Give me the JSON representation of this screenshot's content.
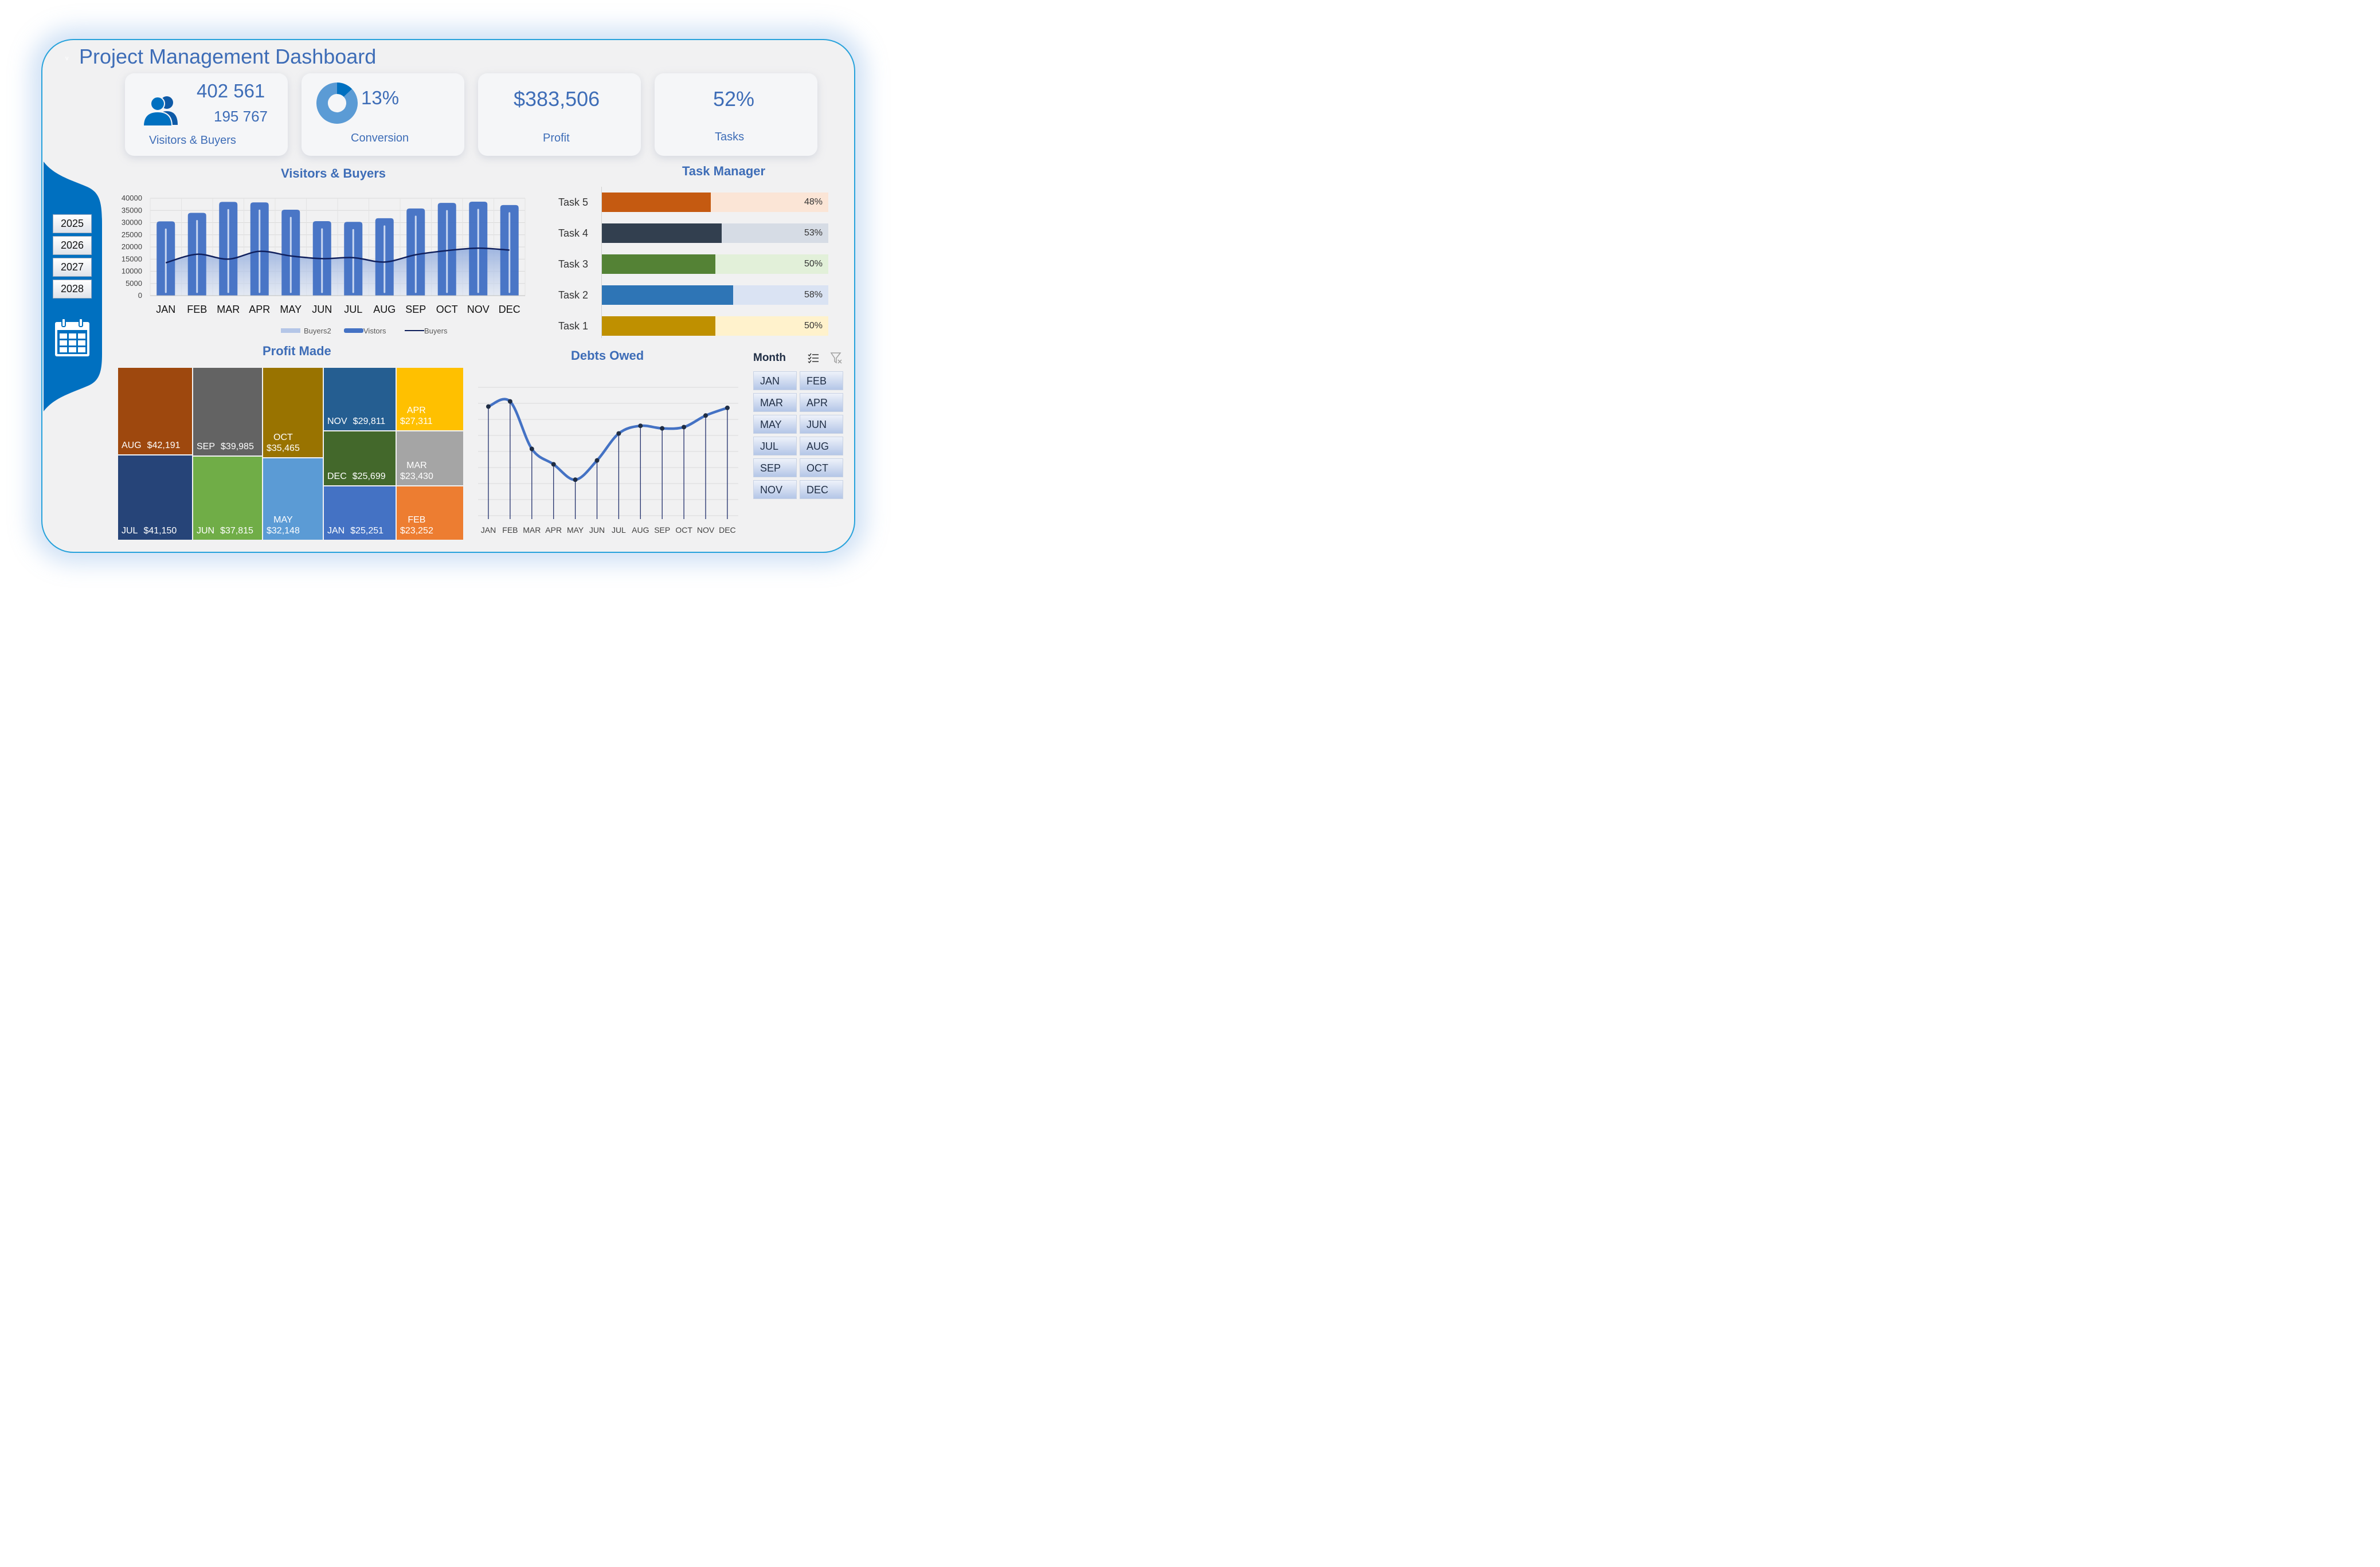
{
  "header": {
    "title": "Project Management Dashboard",
    "chevron": "v"
  },
  "kpis": {
    "visitors": {
      "value": "402 561",
      "sub_value": "195 767",
      "label": "Visitors & Buyers",
      "icon": "users-icon"
    },
    "conversion": {
      "value": "13%",
      "label": "Conversion",
      "percent": 13
    },
    "profit": {
      "value": "$383,506",
      "label": "Profit"
    },
    "tasks": {
      "value": "52%",
      "label": "Tasks"
    }
  },
  "sidebar": {
    "years": [
      "2025",
      "2026",
      "2027",
      "2028"
    ],
    "icon": "calendar-icon"
  },
  "visitors_chart_title": "Visitors & Buyers",
  "task_manager": {
    "title": "Task Manager",
    "tasks": [
      {
        "label": "Task 5",
        "pct": "48%",
        "value": 48,
        "color": "#c55a11",
        "track": "#fbe5d6"
      },
      {
        "label": "Task 4",
        "pct": "53%",
        "value": 53,
        "color": "#323f4f",
        "track": "#d6dce5"
      },
      {
        "label": "Task 3",
        "pct": "50%",
        "value": 50,
        "color": "#548235",
        "track": "#e2f0d9"
      },
      {
        "label": "Task 2",
        "pct": "58%",
        "value": 58,
        "color": "#2e75b6",
        "track": "#dae3f3"
      },
      {
        "label": "Task 1",
        "pct": "50%",
        "value": 50,
        "color": "#bf9000",
        "track": "#fff2cc"
      }
    ]
  },
  "profit_made": {
    "title": "Profit Made",
    "cells": [
      {
        "month": "AUG",
        "amount": "$42,191",
        "color": "#9e480e"
      },
      {
        "month": "JUL",
        "amount": "$41,150",
        "color": "#264478"
      },
      {
        "month": "SEP",
        "amount": "$39,985",
        "color": "#636363"
      },
      {
        "month": "JUN",
        "amount": "$37,815",
        "color": "#70ad47"
      },
      {
        "month": "OCT",
        "amount": "$35,465",
        "color": "#997300"
      },
      {
        "month": "MAY",
        "amount": "$32,148",
        "color": "#5b9bd5"
      },
      {
        "month": "NOV",
        "amount": "$29,811",
        "color": "#255e91"
      },
      {
        "month": "DEC",
        "amount": "$25,699",
        "color": "#43682b"
      },
      {
        "month": "JAN",
        "amount": "$25,251",
        "color": "#4472c4"
      },
      {
        "month": "APR",
        "amount": "$27,311",
        "color": "#ffc000"
      },
      {
        "month": "MAR",
        "amount": "$23,430",
        "color": "#a5a5a5"
      },
      {
        "month": "FEB",
        "amount": "$23,252",
        "color": "#ed7d31"
      }
    ]
  },
  "debts": {
    "title": "Debts Owed"
  },
  "slicer": {
    "title": "Month",
    "multi_select_icon": "multi-select-icon",
    "clear_filter_icon": "clear-filter-icon",
    "months": [
      "JAN",
      "FEB",
      "MAR",
      "APR",
      "MAY",
      "JUN",
      "JUL",
      "AUG",
      "SEP",
      "OCT",
      "NOV",
      "DEC"
    ]
  },
  "chart_data": [
    {
      "type": "bar",
      "title": "Visitors & Buyers",
      "categories": [
        "JAN",
        "FEB",
        "MAR",
        "APR",
        "MAY",
        "JUN",
        "JUL",
        "AUG",
        "SEP",
        "OCT",
        "NOV",
        "DEC"
      ],
      "ylim": [
        0,
        40000
      ],
      "yticks": [
        "40000",
        "35000",
        "30000",
        "25000",
        "20000",
        "15000",
        "10000",
        "5000",
        "0"
      ],
      "legend": [
        "Buyers2",
        "Vistors",
        "Buyers"
      ],
      "legend_position": "bottom",
      "grid": true,
      "series": [
        {
          "name": "Vistors",
          "type": "bar",
          "color": "#4472c4",
          "values": [
            30500,
            34000,
            38500,
            38300,
            35300,
            30600,
            30300,
            31800,
            35800,
            38100,
            38600,
            37200
          ]
        },
        {
          "name": "Buyers",
          "type": "line",
          "color": "#0f1f5c",
          "values": [
            13500,
            17000,
            15000,
            18200,
            16300,
            15200,
            15600,
            13800,
            16800,
            18500,
            19500,
            18700
          ]
        },
        {
          "name": "Buyers2",
          "type": "area",
          "color": "#b4c6e7",
          "values": [
            13500,
            17000,
            15000,
            18200,
            16300,
            15200,
            15600,
            13800,
            16800,
            18500,
            19500,
            18700
          ]
        }
      ]
    },
    {
      "type": "line",
      "title": "Debts Owed",
      "categories": [
        "JAN",
        "FEB",
        "MAR",
        "APR",
        "MAY",
        "JUN",
        "JUL",
        "AUG",
        "SEP",
        "OCT",
        "NOV",
        "DEC"
      ],
      "series": [
        {
          "name": "",
          "color": "#4472c4",
          "values": [
            85,
            89,
            52,
            40,
            28,
            43,
            64,
            70,
            68,
            69,
            78,
            84
          ]
        }
      ],
      "ylim": [
        0,
        100
      ],
      "grid": true
    },
    {
      "type": "pie",
      "title": "Conversion",
      "values": [
        13,
        87
      ],
      "colors": [
        "#0070c0",
        "#5b9bd5"
      ]
    }
  ]
}
